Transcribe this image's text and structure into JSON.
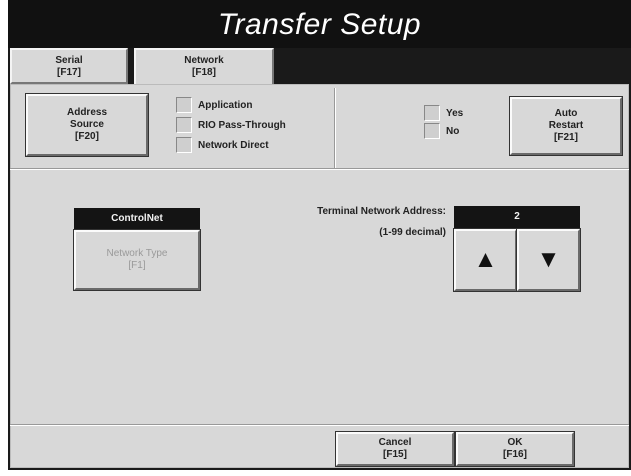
{
  "window": {
    "title": "Transfer Setup"
  },
  "tabs": [
    {
      "label": "Serial",
      "key": "[F17]"
    },
    {
      "label": "Network",
      "key": "[F18]"
    }
  ],
  "address_source": {
    "label1": "Address",
    "label2": "Source",
    "key": "[F20]"
  },
  "source_options": [
    "Application",
    "RIO Pass-Through",
    "Network Direct"
  ],
  "yes_no": [
    "Yes",
    "No"
  ],
  "auto_restart": {
    "label1": "Auto",
    "label2": "Restart",
    "key": "[F21]"
  },
  "network": {
    "name": "ControlNet",
    "type_label": "Network Type",
    "type_key": "[F1]"
  },
  "terminal_address": {
    "label": "Terminal Network Address:",
    "range": "(1-99 decimal)",
    "value": "2",
    "up_icon": "triangle-up-icon",
    "down_icon": "triangle-down-icon"
  },
  "footer": {
    "cancel_label": "Cancel",
    "cancel_key": "[F15]",
    "ok_label": "OK",
    "ok_key": "[F16]"
  }
}
